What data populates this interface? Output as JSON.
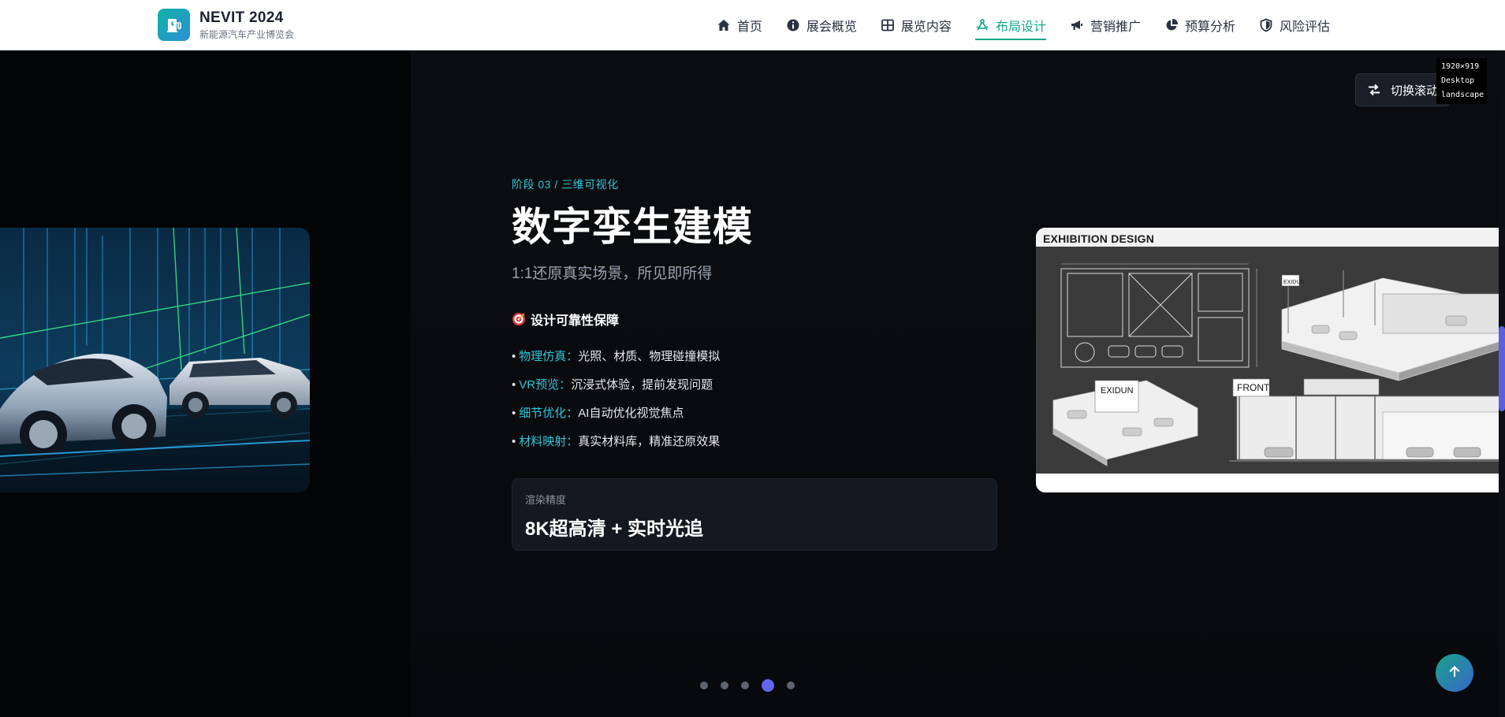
{
  "brand": {
    "title": "NEVIT 2024",
    "subtitle": "新能源汽车产业博览会",
    "logo_icon": "ev-charger-icon"
  },
  "nav": {
    "items": [
      {
        "label": "首页",
        "icon": "home-icon",
        "active": false
      },
      {
        "label": "展会概览",
        "icon": "info-icon",
        "active": false
      },
      {
        "label": "展览内容",
        "icon": "grid-icon",
        "active": false
      },
      {
        "label": "布局设计",
        "icon": "compass-drafting-icon",
        "active": true
      },
      {
        "label": "营销推广",
        "icon": "megaphone-icon",
        "active": false
      },
      {
        "label": "预算分析",
        "icon": "pie-chart-icon",
        "active": false
      },
      {
        "label": "风险评估",
        "icon": "shield-icon",
        "active": false
      }
    ],
    "active_color": "#16a98a"
  },
  "switch_button": {
    "label": "切换滚动",
    "icon": "swap-arrows-icon"
  },
  "resolution_tag": {
    "line1": "1920×919",
    "line2": "Desktop",
    "line3": "landscape"
  },
  "slide": {
    "stage_label": "阶段 03 / 三维可视化",
    "title": "数字孪生建模",
    "subtitle": "1:1还原真实场景，所见即所得",
    "guarantee_title": "设计可靠性保障",
    "guarantee_icon": "target-icon",
    "features": [
      {
        "key": "物理仿真：",
        "text": "光照、材质、物理碰撞模拟"
      },
      {
        "key": "VR预览：",
        "text": "沉浸式体验，提前发现问题"
      },
      {
        "key": "细节优化：",
        "text": "AI自动优化视觉焦点"
      },
      {
        "key": "材料映射：",
        "text": "真实材料库，精准还原效果"
      }
    ],
    "render": {
      "label": "渲染精度",
      "value": "8K超高清 + 实时光追"
    },
    "design_image": {
      "header": "EXHIBITION DESIGN",
      "booth_label_1": "EXIDUN",
      "booth_label_2": "FRONT",
      "booth_label_3": "EXIDUN"
    }
  },
  "pagination": {
    "count": 5,
    "active_index": 3
  },
  "back_to_top": {
    "icon": "arrow-up-icon"
  },
  "colors": {
    "accent": "#2ec7d8",
    "indicator": "#6366f1",
    "header_bg": "#ffffff"
  }
}
